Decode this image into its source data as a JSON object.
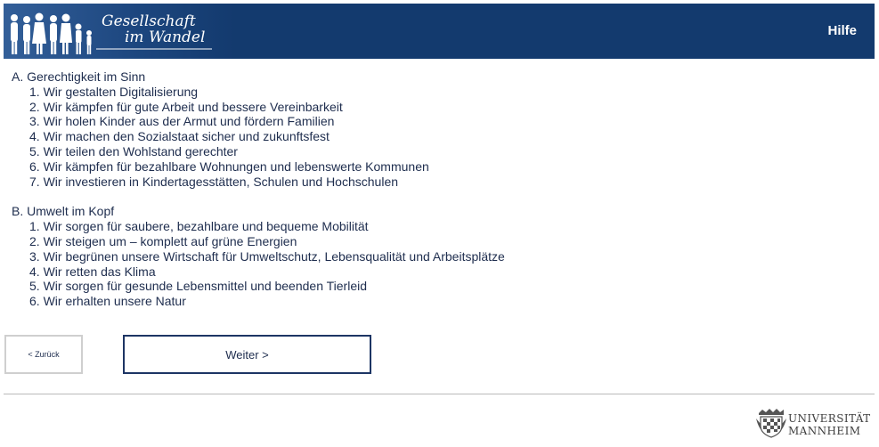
{
  "header": {
    "logo_line1": "Gesellschaft",
    "logo_line2": "im Wandel",
    "help_label": "Hilfe",
    "background_color": "#133a6e"
  },
  "sections": [
    {
      "heading": "A. Gerechtigkeit im Sinn",
      "items": [
        "1. Wir gestalten Digitalisierung",
        "2. Wir kämpfen für gute Arbeit und bessere Vereinbarkeit",
        "3. Wir holen Kinder aus der Armut und fördern Familien",
        "4. Wir machen den Sozialstaat sicher und zukunftsfest",
        "5. Wir teilen den Wohlstand gerechter",
        "6. Wir kämpfen für bezahlbare Wohnungen und lebenswerte Kommunen",
        "7. Wir investieren in Kindertagesstätten, Schulen und Hochschulen"
      ]
    },
    {
      "heading": "B. Umwelt im Kopf",
      "items": [
        "1. Wir sorgen für saubere, bezahlbare und bequeme Mobilität",
        "2. Wir steigen um – komplett auf grüne Energien",
        "3. Wir begrünen unsere Wirtschaft für Umweltschutz, Lebensqualität und Arbeitsplätze",
        "4. Wir retten das Klima",
        "5. Wir sorgen für gesunde Lebensmittel und beenden Tierleid",
        "6. Wir erhalten unsere Natur"
      ]
    }
  ],
  "navigation": {
    "back_label": "< Zurück",
    "next_label": "Weiter >"
  },
  "footer": {
    "university_line1": "UNIVERSITÄT",
    "university_line2": "MANNHEIM",
    "crest_icon": "university-crest-icon"
  },
  "colors": {
    "text": "#1e2d4e",
    "button_border": "#1d3564",
    "divider": "#b9b9b9"
  }
}
